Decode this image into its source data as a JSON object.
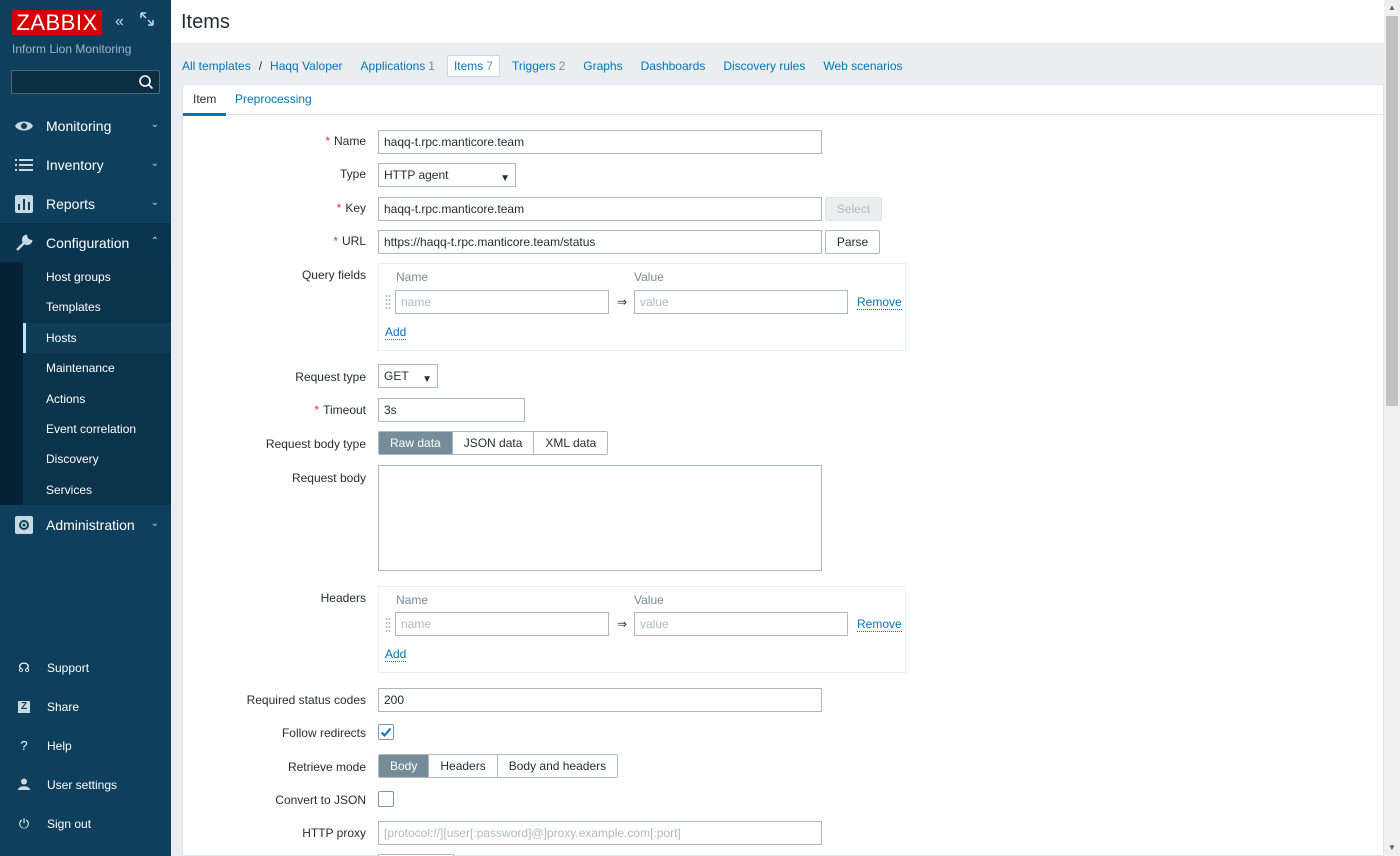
{
  "app": {
    "logo": "ZABBIX",
    "org": "Inform Lion Monitoring"
  },
  "search": {
    "placeholder": ""
  },
  "menu": {
    "items": [
      {
        "label": "Monitoring",
        "icon": "eye-icon"
      },
      {
        "label": "Inventory",
        "icon": "list-icon"
      },
      {
        "label": "Reports",
        "icon": "bar-chart-icon"
      },
      {
        "label": "Configuration",
        "icon": "wrench-icon"
      },
      {
        "label": "Administration",
        "icon": "gear-icon"
      }
    ],
    "configuration_sub": [
      "Host groups",
      "Templates",
      "Hosts",
      "Maintenance",
      "Actions",
      "Event correlation",
      "Discovery",
      "Services"
    ],
    "active_sub": "Hosts",
    "bottom": [
      {
        "label": "Support",
        "icon": "headset-icon"
      },
      {
        "label": "Share",
        "icon": "share-z-icon"
      },
      {
        "label": "Help",
        "icon": "help-icon"
      },
      {
        "label": "User settings",
        "icon": "user-icon"
      },
      {
        "label": "Sign out",
        "icon": "power-icon"
      }
    ]
  },
  "header": {
    "title": "Items"
  },
  "nav": {
    "all_templates": "All templates",
    "slash": "/",
    "template": "Haqq Valoper",
    "applications": "Applications",
    "applications_count": "1",
    "items": "Items",
    "items_count": "7",
    "triggers": "Triggers",
    "triggers_count": "2",
    "graphs": "Graphs",
    "dashboards": "Dashboards",
    "discovery_rules": "Discovery rules",
    "web_scenarios": "Web scenarios"
  },
  "tabs": {
    "item": "Item",
    "preprocessing": "Preprocessing"
  },
  "form": {
    "name_label": "Name",
    "name_value": "haqq-t.rpc.manticore.team",
    "type_label": "Type",
    "type_value": "HTTP agent",
    "key_label": "Key",
    "key_value": "haqq-t.rpc.manticore.team",
    "select_btn": "Select",
    "url_label": "URL",
    "url_value": "https://haqq-t.rpc.manticore.team/status",
    "parse_btn": "Parse",
    "query_fields_label": "Query fields",
    "col_name": "Name",
    "col_value": "Value",
    "name_placeholder": "name",
    "value_placeholder": "value",
    "arrow": "⇒",
    "remove": "Remove",
    "add": "Add",
    "request_type_label": "Request type",
    "request_type_value": "GET",
    "timeout_label": "Timeout",
    "timeout_value": "3s",
    "body_type_label": "Request body type",
    "body_types": [
      "Raw data",
      "JSON data",
      "XML data"
    ],
    "request_body_label": "Request body",
    "headers_label": "Headers",
    "status_codes_label": "Required status codes",
    "status_codes_value": "200",
    "follow_redirects_label": "Follow redirects",
    "follow_redirects": true,
    "retrieve_mode_label": "Retrieve mode",
    "retrieve_modes": [
      "Body",
      "Headers",
      "Body and headers"
    ],
    "convert_json_label": "Convert to JSON",
    "convert_json": false,
    "http_proxy_label": "HTTP proxy",
    "http_proxy_placeholder": "[protocol://][user[:password]@]proxy.example.com[:port]"
  }
}
